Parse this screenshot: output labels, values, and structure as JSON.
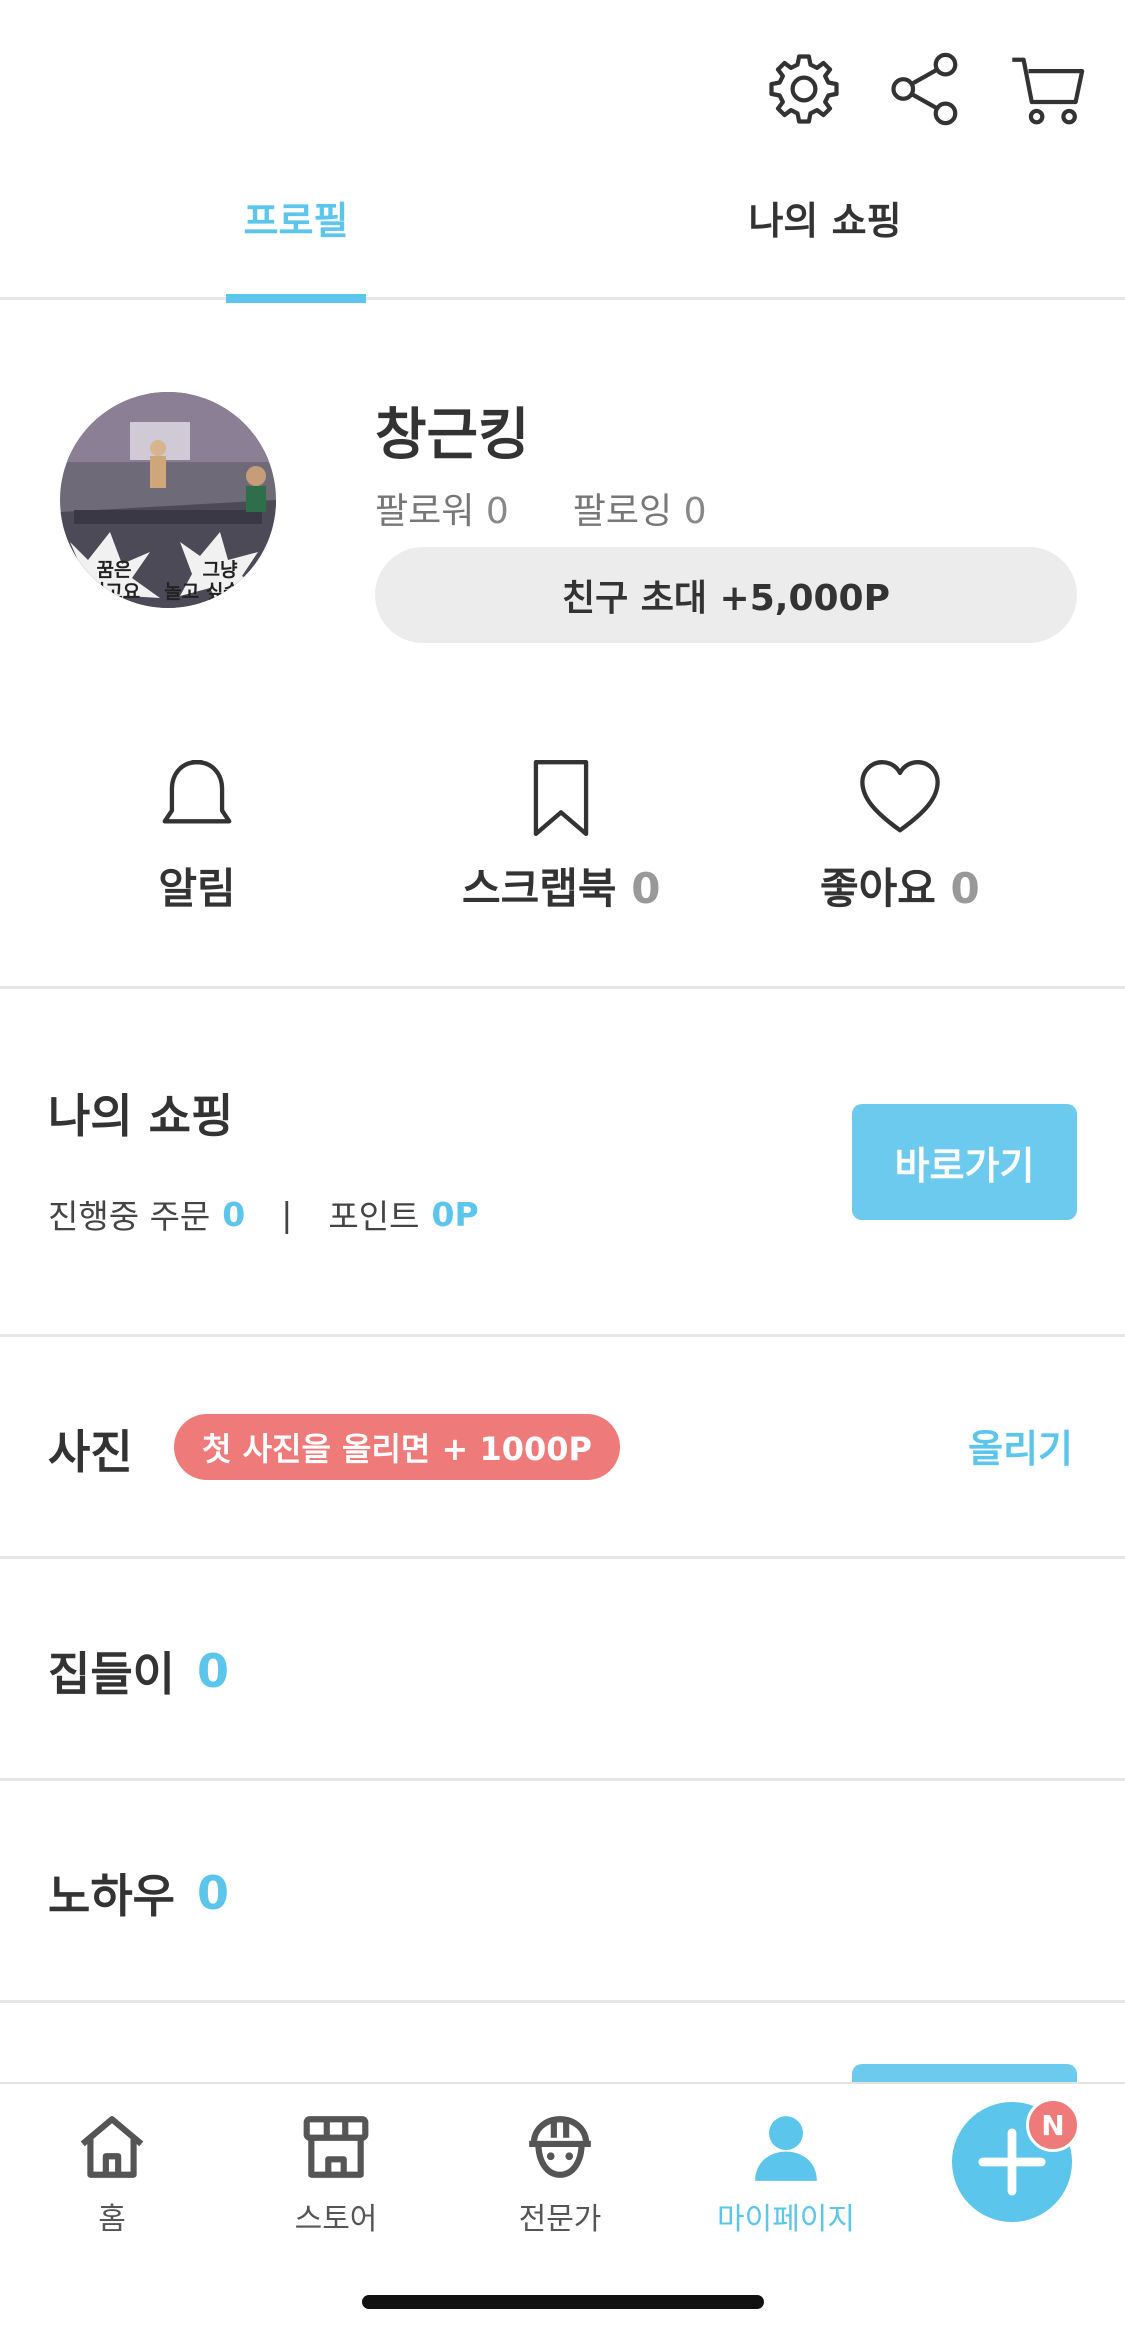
{
  "header": {
    "icons": [
      "gear-icon",
      "share-icon",
      "cart-icon"
    ]
  },
  "tabs": [
    {
      "label": "프로필",
      "active": true
    },
    {
      "label": "나의 쇼핑",
      "active": false
    }
  ],
  "profile": {
    "username": "창근킹",
    "followers_label": "팔로워",
    "followers_count": "0",
    "following_label": "팔로잉",
    "following_count": "0",
    "invite_label": "친구 초대 +5,000P",
    "avatar_caption_left": "꿈은 없고요",
    "avatar_caption_right": "그냥 놀고 싶습니다"
  },
  "quick_actions": [
    {
      "icon": "bell-icon",
      "label": "알림",
      "count": ""
    },
    {
      "icon": "bookmark-icon",
      "label": "스크랩북",
      "count": "0"
    },
    {
      "icon": "heart-icon",
      "label": "좋아요",
      "count": "0"
    }
  ],
  "my_shopping": {
    "title": "나의 쇼핑",
    "orders_label": "진행중 주문",
    "orders_value": "0",
    "separator": "|",
    "points_label": "포인트",
    "points_value": "0P",
    "go_button": "바로가기"
  },
  "photos": {
    "title": "사진",
    "badge": "첫 사진을 올리면 + 1000P",
    "upload_link": "올리기"
  },
  "housewarming": {
    "title": "집들이",
    "count": "0"
  },
  "knowhow": {
    "title": "노하우",
    "count": "0"
  },
  "bottom_nav": {
    "items": [
      {
        "icon": "home-icon",
        "label": "홈",
        "active": false
      },
      {
        "icon": "store-icon",
        "label": "스토어",
        "active": false
      },
      {
        "icon": "expert-helmet-icon",
        "label": "전문가",
        "active": false
      },
      {
        "icon": "person-icon",
        "label": "마이페이지",
        "active": true
      }
    ],
    "fab_badge": "N"
  },
  "colors": {
    "accent": "#5bc5ec",
    "badge_red": "#ef7a7a",
    "button_blue": "#6ccaef",
    "pill_gray": "#ececec"
  }
}
